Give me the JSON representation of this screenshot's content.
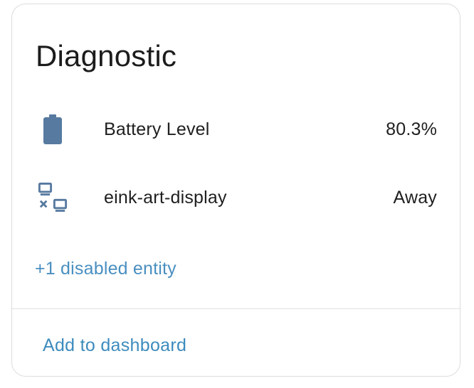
{
  "card": {
    "title": "Diagnostic"
  },
  "entities": [
    {
      "icon": "battery-icon",
      "label": "Battery Level",
      "value": "80.3%"
    },
    {
      "icon": "lan-disconnect-icon",
      "label": "eink-art-display",
      "value": "Away"
    }
  ],
  "disabled_entities_link": "+1 disabled entity",
  "actions": {
    "add_to_dashboard": "Add to dashboard"
  },
  "colors": {
    "icon": "#577aa0",
    "link": "#4a8fc0",
    "text": "#1f1f1f",
    "border": "#dcdcdc"
  }
}
